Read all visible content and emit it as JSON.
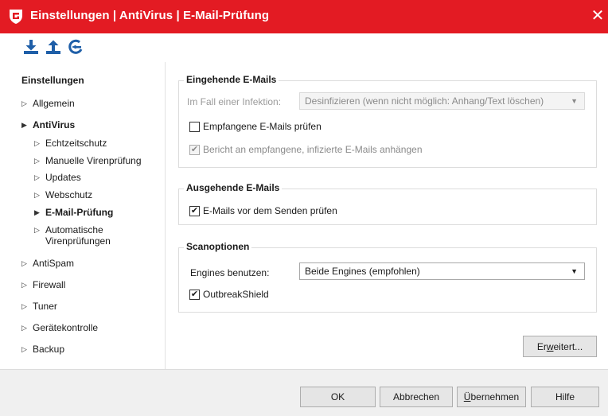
{
  "window": {
    "title": "Einstellungen | AntiVirus | E-Mail-Prüfung",
    "close_symbol": "✕",
    "accent_color": "#e31b23"
  },
  "toolbar": {
    "buttons": [
      {
        "icon": "import-icon"
      },
      {
        "icon": "export-icon"
      },
      {
        "icon": "reset-icon"
      }
    ]
  },
  "sidebar": {
    "heading": "Einstellungen",
    "items": [
      {
        "label": "Allgemein",
        "level": 0
      },
      {
        "label": "AntiVirus",
        "level": 0,
        "expanded": true
      },
      {
        "label": "Echtzeitschutz",
        "level": 1
      },
      {
        "label": "Manuelle Virenprüfung",
        "level": 1
      },
      {
        "label": "Updates",
        "level": 1
      },
      {
        "label": "Webschutz",
        "level": 1
      },
      {
        "label": "E-Mail-Prüfung",
        "level": 1,
        "selected": true
      },
      {
        "label": "Automatische",
        "label2": "Virenprüfungen",
        "level": 1
      },
      {
        "label": "AntiSpam",
        "level": 0
      },
      {
        "label": "Firewall",
        "level": 0
      },
      {
        "label": "Tuner",
        "level": 0
      },
      {
        "label": "Gerätekontrolle",
        "level": 0
      },
      {
        "label": "Backup",
        "level": 0
      }
    ]
  },
  "incoming": {
    "legend": "Eingehende E-Mails",
    "infection_label": "Im Fall einer Infektion:",
    "infection_value": "Desinfizieren (wenn nicht möglich: Anhang/Text löschen)",
    "check_incoming_label": "Empfangene E-Mails prüfen",
    "check_incoming_checked": false,
    "attach_report_label": "Bericht an empfangene, infizierte E-Mails anhängen",
    "attach_report_checked": true
  },
  "outgoing": {
    "legend": "Ausgehende E-Mails",
    "check_outgoing_label": "E-Mails vor dem Senden prüfen",
    "check_outgoing_checked": true
  },
  "scan": {
    "legend": "Scanoptionen",
    "engines_label": "Engines benutzen:",
    "engines_value": "Beide Engines (empfohlen)",
    "outbreak_label": "OutbreakShield",
    "outbreak_checked": true
  },
  "advanced_button": {
    "pre": "Er",
    "accel": "w",
    "post": "eitert..."
  },
  "footer": {
    "ok": "OK",
    "cancel": "Abbrechen",
    "apply": {
      "pre": "",
      "accel": "Ü",
      "post": "bernehmen"
    },
    "help": "Hilfe"
  },
  "check_mark": "✔",
  "caret": "▼",
  "nav_arrow_collapsed": "▷",
  "nav_arrow_expanded": "▶"
}
